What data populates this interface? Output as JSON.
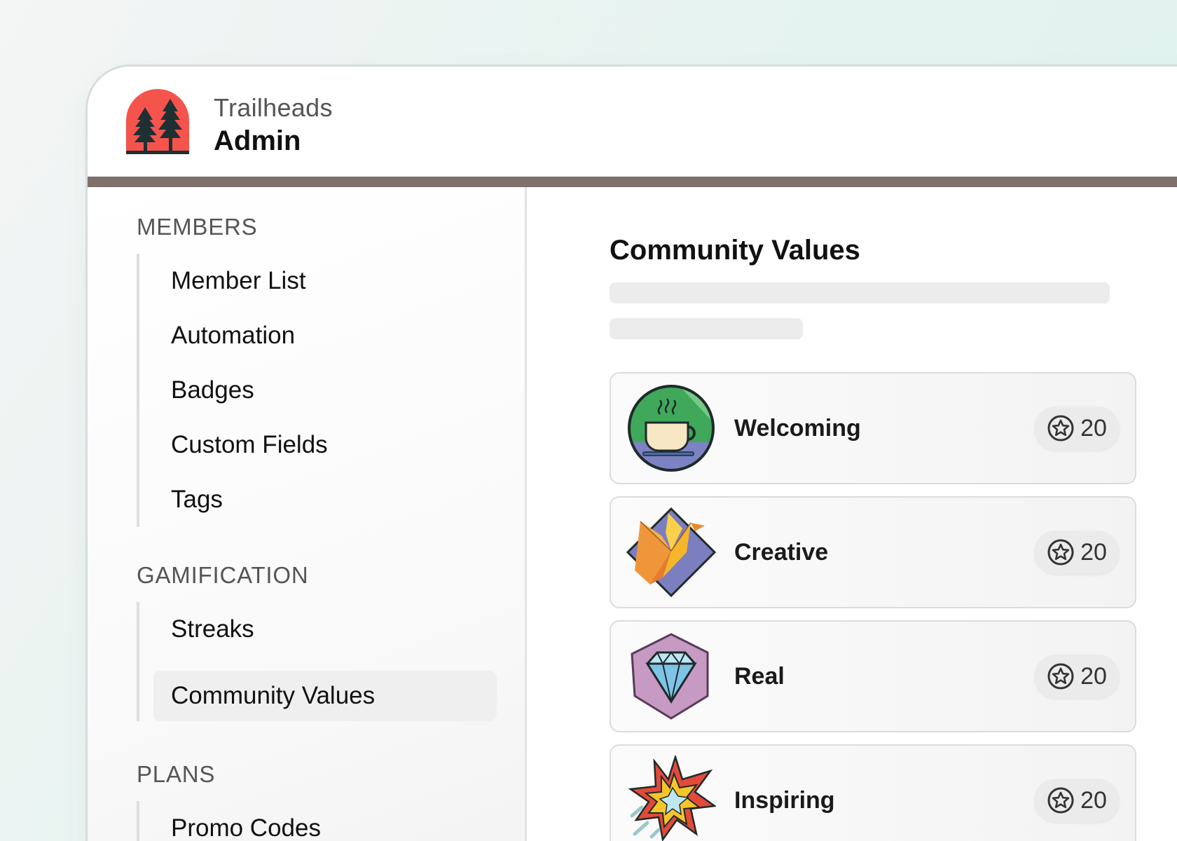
{
  "brand": {
    "org": "Trailheads",
    "title": "Admin",
    "logo_icon": "trees-logo-icon",
    "logo_color": "#f4544c"
  },
  "sidebar": {
    "sections": [
      {
        "title": "MEMBERS",
        "items": [
          {
            "label": "Member List"
          },
          {
            "label": "Automation"
          },
          {
            "label": "Badges"
          },
          {
            "label": "Custom Fields"
          },
          {
            "label": "Tags"
          }
        ]
      },
      {
        "title": "GAMIFICATION",
        "items": [
          {
            "label": "Streaks"
          },
          {
            "label": "Community Values",
            "active": true
          }
        ]
      },
      {
        "title": "PLANS",
        "items": [
          {
            "label": "Promo Codes"
          }
        ]
      }
    ]
  },
  "main": {
    "title": "Community Values",
    "values": [
      {
        "name": "Welcoming",
        "points": "20",
        "icon": "coffee-cup-badge-icon"
      },
      {
        "name": "Creative",
        "points": "20",
        "icon": "origami-crane-badge-icon"
      },
      {
        "name": "Real",
        "points": "20",
        "icon": "diamond-badge-icon"
      },
      {
        "name": "Inspiring",
        "points": "20",
        "icon": "starburst-badge-icon"
      }
    ],
    "points_icon": "star-circle-icon"
  },
  "colors": {
    "header_bar": "#7e706a",
    "active_item_bg": "#efefef"
  }
}
